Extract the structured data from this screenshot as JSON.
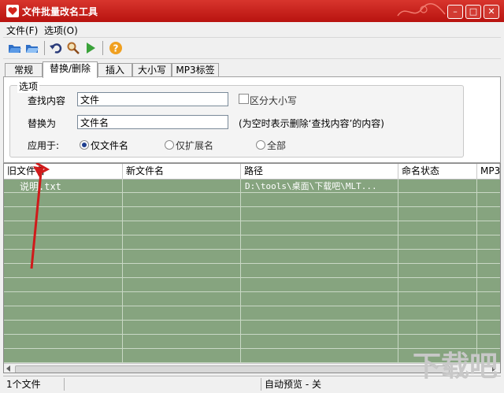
{
  "window": {
    "title": "文件批量改名工具"
  },
  "menu": {
    "file": "文件(F)",
    "options": "选项(O)"
  },
  "tabs": [
    "常规",
    "替换/删除",
    "插入",
    "大小写",
    "MP3标签"
  ],
  "panel": {
    "group_label": "选项",
    "find_label": "查找内容",
    "find_value": "文件",
    "case_label": "区分大小写",
    "replace_label": "替换为",
    "replace_value": "文件名",
    "replace_hint": "(为空时表示删除‘查找内容’的内容)",
    "apply_label": "应用于:",
    "apply_options": [
      "仅文件名",
      "仅扩展名",
      "全部"
    ],
    "apply_selected": "仅文件名"
  },
  "grid": {
    "columns": [
      "旧文件名",
      "新文件名",
      "路径",
      "命名状态",
      "MP3"
    ],
    "rows": [
      {
        "old": "说明.txt",
        "new": "",
        "path": "D:\\tools\\桌面\\下载吧\\MLT...",
        "status": "",
        "mp3": ""
      }
    ]
  },
  "status": {
    "count": "1个文件",
    "preview": "自动预览 - 关"
  },
  "colors": {
    "title_red": "#c8201c",
    "grid_green": "#86a47f"
  },
  "icons": [
    "heart-icon",
    "open-folder-icon",
    "save-folder-icon",
    "undo-icon",
    "search-icon",
    "play-icon",
    "help-icon",
    "minimize-icon",
    "maximize-icon",
    "close-icon"
  ]
}
